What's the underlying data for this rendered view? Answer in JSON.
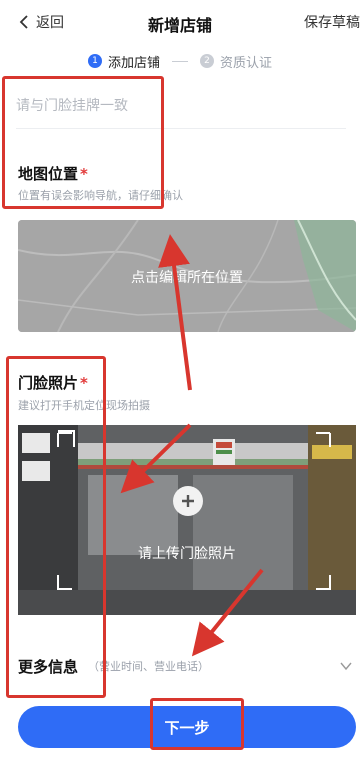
{
  "header": {
    "back_label": "返回",
    "title": "新增店铺",
    "save_label": "保存草稿"
  },
  "stepper": {
    "steps": [
      {
        "num": "1",
        "label": "添加店铺",
        "state": "active"
      },
      {
        "num": "2",
        "label": "资质认证",
        "state": "inactive"
      }
    ]
  },
  "store_name": {
    "value": "",
    "placeholder": "请与门脸挂牌一致"
  },
  "map_section": {
    "title": "地图位置",
    "required_mark": "*",
    "hint": "位置有误会影响导航，请仔细确认",
    "map_prompt": "点击编辑所在位置"
  },
  "photo_section": {
    "title": "门脸照片",
    "required_mark": "*",
    "hint": "建议打开手机定位现场拍摄",
    "upload_prompt": "请上传门脸照片"
  },
  "more_info": {
    "title": "更多信息",
    "hint": "（营业时间、营业电话）"
  },
  "footer": {
    "next_label": "下一步"
  },
  "colors": {
    "primary": "#2f6cf6",
    "annotation_red": "#d8362e",
    "required_red": "#e23b3b"
  },
  "icons": {
    "back": "chevron-left-icon",
    "plus": "plus-icon",
    "expand": "chevron-down-icon"
  }
}
